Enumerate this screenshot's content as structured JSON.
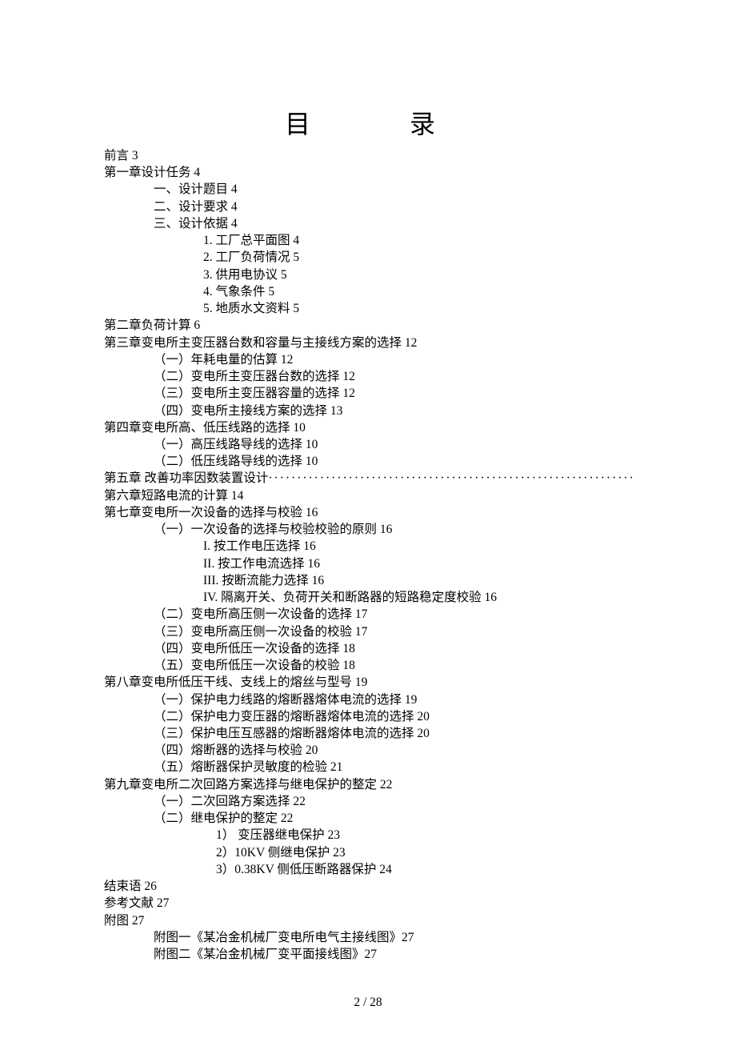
{
  "title": "目　　录",
  "entries": [
    {
      "indent": 0,
      "text": "前言 3"
    },
    {
      "indent": 0,
      "text": "第一章设计任务 4"
    },
    {
      "indent": 1,
      "text": "一、设计题目 4"
    },
    {
      "indent": 1,
      "text": "二、设计要求 4"
    },
    {
      "indent": 1,
      "text": "三、设计依据 4"
    },
    {
      "indent": 2,
      "text": "1. 工厂总平面图 4"
    },
    {
      "indent": 2,
      "text": "2. 工厂负荷情况 5"
    },
    {
      "indent": 2,
      "text": "3. 供用电协议 5"
    },
    {
      "indent": 2,
      "text": "4. 气象条件 5"
    },
    {
      "indent": 2,
      "text": "5. 地质水文资料 5"
    },
    {
      "indent": 0,
      "text": "第二章负荷计算 6"
    },
    {
      "indent": 0,
      "text": "第三章变电所主变压器台数和容量与主接线方案的选择 12"
    },
    {
      "indent": 1,
      "text": "（一）年耗电量的估算 12"
    },
    {
      "indent": 1,
      "text": "（二）变电所主变压器台数的选择 12"
    },
    {
      "indent": 1,
      "text": "（三）变电所主变压器容量的选择 12"
    },
    {
      "indent": 1,
      "text": "（四）变电所主接线方案的选择 13"
    },
    {
      "indent": 0,
      "text": "第四章变电所高、低压线路的选择 10"
    },
    {
      "indent": 1,
      "text": "（一）高压线路导线的选择 10"
    },
    {
      "indent": 1,
      "text": "（二）低压线路导线的选择 10"
    },
    {
      "indent": 0,
      "text": "第五章 改善功率因数装置设计",
      "dotted": true
    },
    {
      "indent": 0,
      "text": "第六章短路电流的计算 14"
    },
    {
      "indent": 0,
      "text": "第七章变电所一次设备的选择与校验 16"
    },
    {
      "indent": 1,
      "text": "（一）一次设备的选择与校验校验的原则 16"
    },
    {
      "indent": 2,
      "text": "I. 按工作电压选择 16"
    },
    {
      "indent": 2,
      "text": "II. 按工作电流选择 16"
    },
    {
      "indent": 2,
      "text": "III. 按断流能力选择 16"
    },
    {
      "indent": 2,
      "text": "IV. 隔离开关、负荷开关和断路器的短路稳定度校验 16"
    },
    {
      "indent": 1,
      "text": "（二）变电所高压侧一次设备的选择 17"
    },
    {
      "indent": 1,
      "text": "（三）变电所高压侧一次设备的校验 17"
    },
    {
      "indent": 1,
      "text": "（四）变电所低压一次设备的选择 18"
    },
    {
      "indent": 1,
      "text": "（五）变电所低压一次设备的校验 18"
    },
    {
      "indent": 0,
      "text": "第八章变电所低压干线、支线上的熔丝与型号 19"
    },
    {
      "indent": 1,
      "text": "（一）保护电力线路的熔断器熔体电流的选择 19"
    },
    {
      "indent": 1,
      "text": "（二）保护电力变压器的熔断器熔体电流的选择 20"
    },
    {
      "indent": 1,
      "text": "（三）保护电压互感器的熔断器熔体电流的选择 20"
    },
    {
      "indent": 1,
      "text": "（四）熔断器的选择与校验 20"
    },
    {
      "indent": 1,
      "text": "（五）熔断器保护灵敏度的检验 21"
    },
    {
      "indent": 0,
      "text": "第九章变电所二次回路方案选择与继电保护的整定 22"
    },
    {
      "indent": 1,
      "text": "（一）二次回路方案选择 22"
    },
    {
      "indent": 1,
      "text": "（二）继电保护的整定 22"
    },
    {
      "indent": 3,
      "text": "1） 变压器继电保护 23"
    },
    {
      "indent": 3,
      "text": "2）10KV 侧继电保护 23"
    },
    {
      "indent": 3,
      "text": "3）0.38KV 侧低压断路器保护 24"
    },
    {
      "indent": 0,
      "text": "结束语 26"
    },
    {
      "indent": 0,
      "text": "参考文献 27"
    },
    {
      "indent": 0,
      "text": "附图 27"
    },
    {
      "indent": 1,
      "text": "附图一《某冶金机械厂变电所电气主接线图》27"
    },
    {
      "indent": 1,
      "text": "附图二《某冶金机械厂变平面接线图》27"
    }
  ],
  "pager": "2 / 28"
}
